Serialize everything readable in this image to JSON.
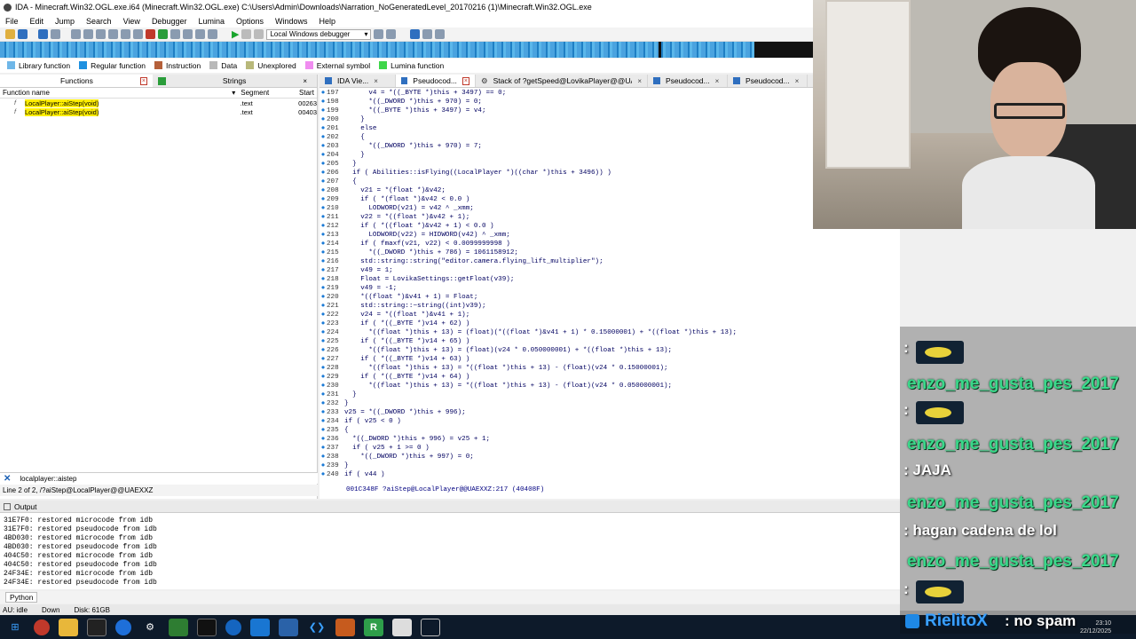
{
  "window": {
    "title": "IDA - Minecraft.Win32.OGL.exe.i64 (Minecraft.Win32.OGL.exe) C:\\Users\\Admin\\Downloads\\Narration_NoGeneratedLevel_20170216 (1)\\Minecraft.Win32.OGL.exe"
  },
  "menu": [
    "File",
    "Edit",
    "Jump",
    "Search",
    "View",
    "Debugger",
    "Lumina",
    "Options",
    "Windows",
    "Help"
  ],
  "toolbar": {
    "debugger": "Local Windows debugger"
  },
  "legend": [
    {
      "label": "Library function",
      "color": "#6fb7e8"
    },
    {
      "label": "Regular function",
      "color": "#1e90e0"
    },
    {
      "label": "Instruction",
      "color": "#b5603a"
    },
    {
      "label": "Data",
      "color": "#b9b9b9"
    },
    {
      "label": "Unexplored",
      "color": "#b8b87a"
    },
    {
      "label": "External symbol",
      "color": "#f08cf0"
    },
    {
      "label": "Lumina function",
      "color": "#3ed64a"
    }
  ],
  "functions_panel": {
    "tab_functions": "Functions",
    "tab_strings": "Strings",
    "col_name": "Function name",
    "col_segment": "Segment",
    "col_start": "Start",
    "rows": [
      {
        "name": "LocalPlayer::aiStep(void)",
        "segment": ".text",
        "start": "00263"
      },
      {
        "name": "LocalPlayer::aiStep(void)",
        "segment": ".text",
        "start": "00403"
      }
    ],
    "filter": "localplayer::aistep",
    "status": "Line 2 of 2, /?aiStep@LocalPlayer@@UAEXXZ"
  },
  "code_tabs": [
    {
      "label": "IDA Vie..."
    },
    {
      "label": "Pseudocod..."
    },
    {
      "label": "Stack of ?getSpeed@LovikaPlayer@@UAE..."
    },
    {
      "label": "Pseudocod..."
    },
    {
      "label": "Pseudocod..."
    }
  ],
  "code_lines": [
    {
      "n": "197",
      "t": "      v4 = *((_BYTE *)this + 3497) == 0;"
    },
    {
      "n": "198",
      "t": "      *((_DWORD *)this + 970) = 0;"
    },
    {
      "n": "199",
      "t": "      *((_BYTE *)this + 3497) = v4;"
    },
    {
      "n": "200",
      "t": "    }"
    },
    {
      "n": "201",
      "t": "    else"
    },
    {
      "n": "202",
      "t": "    {"
    },
    {
      "n": "203",
      "t": "      *((_DWORD *)this + 970) = 7;"
    },
    {
      "n": "204",
      "t": "    }"
    },
    {
      "n": "205",
      "t": "  }"
    },
    {
      "n": "206",
      "t": "  if ( Abilities::isFlying((LocalPlayer *)((char *)this + 3496)) )"
    },
    {
      "n": "207",
      "t": "  {"
    },
    {
      "n": "208",
      "t": "    v21 = *(float *)&v42;"
    },
    {
      "n": "209",
      "t": "    if ( *(float *)&v42 < 0.0 )"
    },
    {
      "n": "210",
      "t": "      LODWORD(v21) = v42 ^ _xmm;"
    },
    {
      "n": "211",
      "t": "    v22 = *((float *)&v42 + 1);"
    },
    {
      "n": "212",
      "t": "    if ( *((float *)&v42 + 1) < 0.0 )"
    },
    {
      "n": "213",
      "t": "      LODWORD(v22) = HIDWORD(v42) ^ _xmm;"
    },
    {
      "n": "214",
      "t": "    if ( fmaxf(v21, v22) < 0.0099999998 )"
    },
    {
      "n": "215",
      "t": "      *((_DWORD *)this + 786) = 1061158912;"
    },
    {
      "n": "216",
      "t": "    std::string::string(\"editor.camera.flying_lift_multiplier\");"
    },
    {
      "n": "217",
      "t": "    v49 = 1;"
    },
    {
      "n": "218",
      "t": "    Float = LovikaSettings::getFloat(v39);"
    },
    {
      "n": "219",
      "t": "    v49 = -1;"
    },
    {
      "n": "220",
      "t": "    *((float *)&v41 + 1) = Float;"
    },
    {
      "n": "221",
      "t": "    std::string::~string((int)v39);"
    },
    {
      "n": "222",
      "t": "    v24 = *((float *)&v41 + 1);"
    },
    {
      "n": "223",
      "t": "    if ( *((_BYTE *)v14 + 62) )"
    },
    {
      "n": "224",
      "t": "      *((float *)this + 13) = (float)(*((float *)&v41 + 1) * 0.15000001) + *((float *)this + 13);"
    },
    {
      "n": "225",
      "t": "    if ( *((_BYTE *)v14 + 65) )"
    },
    {
      "n": "226",
      "t": "      *((float *)this + 13) = (float)(v24 * 0.050000001) + *((float *)this + 13);"
    },
    {
      "n": "227",
      "t": "    if ( *((_BYTE *)v14 + 63) )"
    },
    {
      "n": "228",
      "t": "      *((float *)this + 13) = *((float *)this + 13) - (float)(v24 * 0.15000001);"
    },
    {
      "n": "229",
      "t": "    if ( *((_BYTE *)v14 + 64) )"
    },
    {
      "n": "230",
      "t": "      *((float *)this + 13) = *((float *)this + 13) - (float)(v24 * 0.050000001);"
    },
    {
      "n": "231",
      "t": "  }"
    },
    {
      "n": "232",
      "t": "}"
    },
    {
      "n": "233",
      "t": "v25 = *((_DWORD *)this + 996);"
    },
    {
      "n": "234",
      "t": "if ( v25 < 0 )"
    },
    {
      "n": "235",
      "t": "{"
    },
    {
      "n": "236",
      "t": "  *((_DWORD *)this + 996) = v25 + 1;"
    },
    {
      "n": "237",
      "t": "  if ( v25 + 1 >= 0 )"
    },
    {
      "n": "238",
      "t": "    *((_DWORD *)this + 997) = 0;"
    },
    {
      "n": "239",
      "t": "}"
    },
    {
      "n": "240",
      "t": "if ( v44 )"
    }
  ],
  "code_status": "001C348F ?aiStep@LocalPlayer@@UAEXXZ:217 (40408F)",
  "output": {
    "title": "Output",
    "lines": [
      "31E7F0: restored microcode from idb",
      "31E7F0: restored pseudocode from idb",
      "4BD030: restored microcode from idb",
      "4BD030: restored pseudocode from idb",
      "404C50: restored microcode from idb",
      "404C50: restored pseudocode from idb",
      "24F34E: restored microcode from idb",
      "24F34E: restored pseudocode from idb"
    ],
    "python_tab": "Python"
  },
  "ida_status": {
    "au": "AU:",
    "state": "idle",
    "dir": "Down",
    "disk": "Disk: 61GB"
  },
  "chat": {
    "username": "enzo_me_gusta_pes_2017",
    "messages": [
      {
        "text": ":"
      },
      {
        "text": ":"
      },
      {
        "text": ": JAJA"
      },
      {
        "text": ": hagan cadena de lol"
      },
      {
        "text": ":"
      }
    ],
    "last_user": "RielitoX",
    "last_text": ": no spam"
  },
  "clock": {
    "time": "23:10",
    "date": "22/12/2025"
  }
}
